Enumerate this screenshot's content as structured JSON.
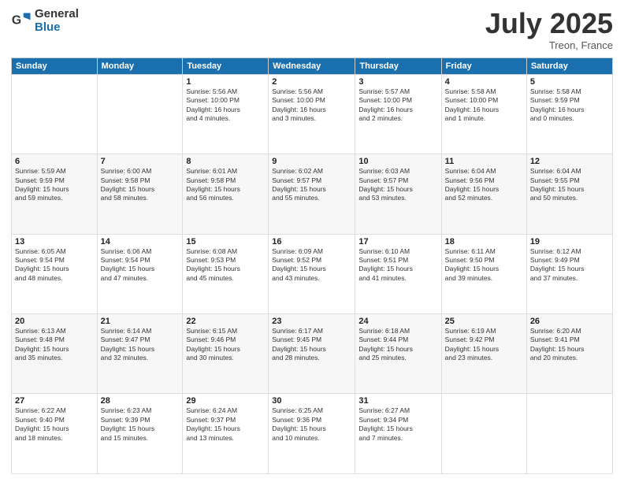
{
  "logo": {
    "general": "General",
    "blue": "Blue"
  },
  "header": {
    "month": "July 2025",
    "location": "Treon, France"
  },
  "weekdays": [
    "Sunday",
    "Monday",
    "Tuesday",
    "Wednesday",
    "Thursday",
    "Friday",
    "Saturday"
  ],
  "weeks": [
    [
      {
        "day": "",
        "info": ""
      },
      {
        "day": "",
        "info": ""
      },
      {
        "day": "1",
        "info": "Sunrise: 5:56 AM\nSunset: 10:00 PM\nDaylight: 16 hours\nand 4 minutes."
      },
      {
        "day": "2",
        "info": "Sunrise: 5:56 AM\nSunset: 10:00 PM\nDaylight: 16 hours\nand 3 minutes."
      },
      {
        "day": "3",
        "info": "Sunrise: 5:57 AM\nSunset: 10:00 PM\nDaylight: 16 hours\nand 2 minutes."
      },
      {
        "day": "4",
        "info": "Sunrise: 5:58 AM\nSunset: 10:00 PM\nDaylight: 16 hours\nand 1 minute."
      },
      {
        "day": "5",
        "info": "Sunrise: 5:58 AM\nSunset: 9:59 PM\nDaylight: 16 hours\nand 0 minutes."
      }
    ],
    [
      {
        "day": "6",
        "info": "Sunrise: 5:59 AM\nSunset: 9:59 PM\nDaylight: 15 hours\nand 59 minutes."
      },
      {
        "day": "7",
        "info": "Sunrise: 6:00 AM\nSunset: 9:58 PM\nDaylight: 15 hours\nand 58 minutes."
      },
      {
        "day": "8",
        "info": "Sunrise: 6:01 AM\nSunset: 9:58 PM\nDaylight: 15 hours\nand 56 minutes."
      },
      {
        "day": "9",
        "info": "Sunrise: 6:02 AM\nSunset: 9:57 PM\nDaylight: 15 hours\nand 55 minutes."
      },
      {
        "day": "10",
        "info": "Sunrise: 6:03 AM\nSunset: 9:57 PM\nDaylight: 15 hours\nand 53 minutes."
      },
      {
        "day": "11",
        "info": "Sunrise: 6:04 AM\nSunset: 9:56 PM\nDaylight: 15 hours\nand 52 minutes."
      },
      {
        "day": "12",
        "info": "Sunrise: 6:04 AM\nSunset: 9:55 PM\nDaylight: 15 hours\nand 50 minutes."
      }
    ],
    [
      {
        "day": "13",
        "info": "Sunrise: 6:05 AM\nSunset: 9:54 PM\nDaylight: 15 hours\nand 48 minutes."
      },
      {
        "day": "14",
        "info": "Sunrise: 6:06 AM\nSunset: 9:54 PM\nDaylight: 15 hours\nand 47 minutes."
      },
      {
        "day": "15",
        "info": "Sunrise: 6:08 AM\nSunset: 9:53 PM\nDaylight: 15 hours\nand 45 minutes."
      },
      {
        "day": "16",
        "info": "Sunrise: 6:09 AM\nSunset: 9:52 PM\nDaylight: 15 hours\nand 43 minutes."
      },
      {
        "day": "17",
        "info": "Sunrise: 6:10 AM\nSunset: 9:51 PM\nDaylight: 15 hours\nand 41 minutes."
      },
      {
        "day": "18",
        "info": "Sunrise: 6:11 AM\nSunset: 9:50 PM\nDaylight: 15 hours\nand 39 minutes."
      },
      {
        "day": "19",
        "info": "Sunrise: 6:12 AM\nSunset: 9:49 PM\nDaylight: 15 hours\nand 37 minutes."
      }
    ],
    [
      {
        "day": "20",
        "info": "Sunrise: 6:13 AM\nSunset: 9:48 PM\nDaylight: 15 hours\nand 35 minutes."
      },
      {
        "day": "21",
        "info": "Sunrise: 6:14 AM\nSunset: 9:47 PM\nDaylight: 15 hours\nand 32 minutes."
      },
      {
        "day": "22",
        "info": "Sunrise: 6:15 AM\nSunset: 9:46 PM\nDaylight: 15 hours\nand 30 minutes."
      },
      {
        "day": "23",
        "info": "Sunrise: 6:17 AM\nSunset: 9:45 PM\nDaylight: 15 hours\nand 28 minutes."
      },
      {
        "day": "24",
        "info": "Sunrise: 6:18 AM\nSunset: 9:44 PM\nDaylight: 15 hours\nand 25 minutes."
      },
      {
        "day": "25",
        "info": "Sunrise: 6:19 AM\nSunset: 9:42 PM\nDaylight: 15 hours\nand 23 minutes."
      },
      {
        "day": "26",
        "info": "Sunrise: 6:20 AM\nSunset: 9:41 PM\nDaylight: 15 hours\nand 20 minutes."
      }
    ],
    [
      {
        "day": "27",
        "info": "Sunrise: 6:22 AM\nSunset: 9:40 PM\nDaylight: 15 hours\nand 18 minutes."
      },
      {
        "day": "28",
        "info": "Sunrise: 6:23 AM\nSunset: 9:39 PM\nDaylight: 15 hours\nand 15 minutes."
      },
      {
        "day": "29",
        "info": "Sunrise: 6:24 AM\nSunset: 9:37 PM\nDaylight: 15 hours\nand 13 minutes."
      },
      {
        "day": "30",
        "info": "Sunrise: 6:25 AM\nSunset: 9:36 PM\nDaylight: 15 hours\nand 10 minutes."
      },
      {
        "day": "31",
        "info": "Sunrise: 6:27 AM\nSunset: 9:34 PM\nDaylight: 15 hours\nand 7 minutes."
      },
      {
        "day": "",
        "info": ""
      },
      {
        "day": "",
        "info": ""
      }
    ]
  ]
}
